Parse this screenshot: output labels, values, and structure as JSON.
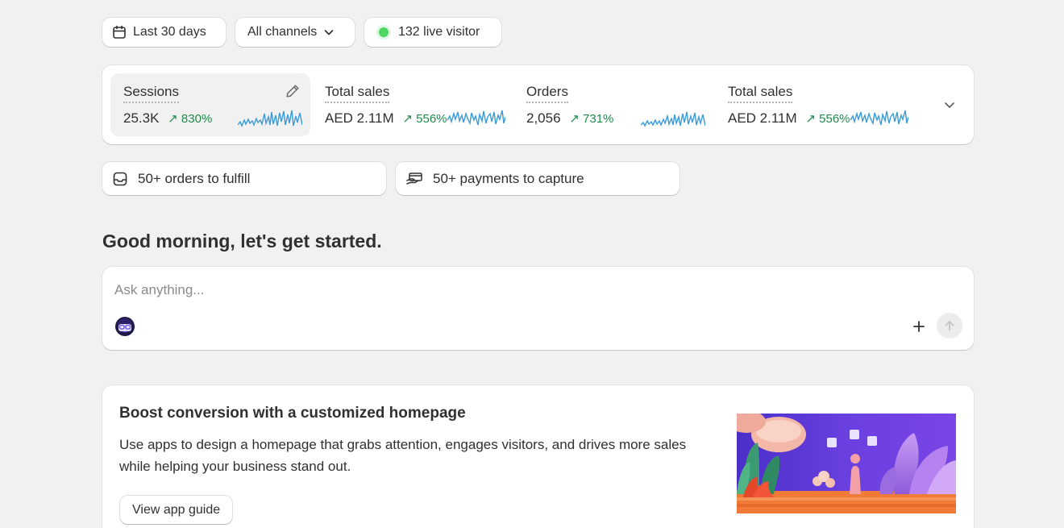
{
  "filters": {
    "date_range": "Last 30 days",
    "channels": "All channels",
    "live_visitors": "132 live visitor"
  },
  "metrics": [
    {
      "label": "Sessions",
      "value": "25.3K",
      "change": "830%"
    },
    {
      "label": "Total sales",
      "value": "AED 2.11M",
      "change": "556%"
    },
    {
      "label": "Orders",
      "value": "2,056",
      "change": "731%"
    },
    {
      "label": "Total sales",
      "value": "AED 2.11M",
      "change": "556%"
    }
  ],
  "tasks": {
    "orders": "50+ orders to fulfill",
    "payments": "50+ payments to capture"
  },
  "greeting": "Good morning, let's get started.",
  "ask": {
    "placeholder": "Ask anything..."
  },
  "promo": {
    "title": "Boost conversion with a customized homepage",
    "body": "Use apps to design a homepage that grabs attention, engages visitors, and drives more sales while helping your business stand out.",
    "button": "View app guide"
  },
  "colors": {
    "positive": "#1f8a4c",
    "sparkline": "#3a9bd9",
    "live": "#4ed760"
  },
  "icons": {
    "calendar": "calendar-icon",
    "chevron": "chevron-down-icon",
    "edit": "pencil-icon",
    "inbox": "inbox-icon",
    "payment": "payment-icon",
    "plus": "plus-icon",
    "send": "arrow-up-icon"
  }
}
